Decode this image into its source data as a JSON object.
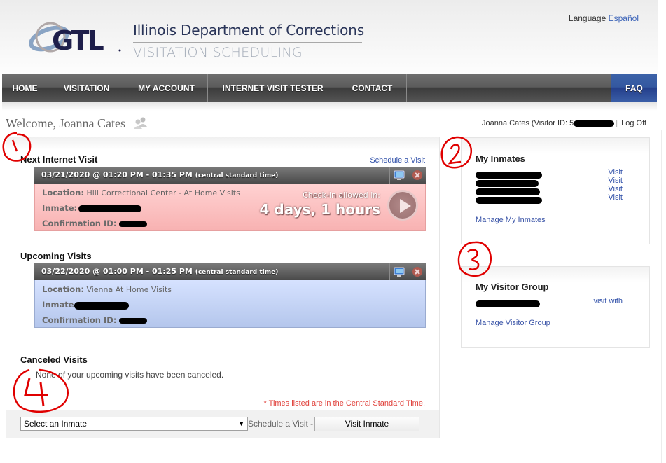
{
  "header": {
    "logo_text": "GTL",
    "title": "Illinois Department of Corrections",
    "subtitle": "VISITATION SCHEDULING",
    "language_label": "Language",
    "language_link": "Español"
  },
  "nav": {
    "items": [
      {
        "label": "HOME"
      },
      {
        "label": "VISITATION"
      },
      {
        "label": "MY ACCOUNT"
      },
      {
        "label": "INTERNET VISIT TESTER"
      },
      {
        "label": "CONTACT"
      }
    ],
    "faq": "FAQ"
  },
  "welcome": {
    "text": "Welcome, Joanna Cates",
    "user_label": "Joanna Cates (Visitor ID: 5",
    "logoff": "Log Off"
  },
  "next_visit": {
    "section_title": "Next Internet Visit",
    "schedule_link": "Schedule a Visit",
    "datetime": "03/21/2020 @ 01:20 PM - 01:35 PM",
    "timezone": "(central standard time)",
    "location_label": "Location:",
    "location": "Hill Correctional Center - At Home Visits",
    "inmate_label": "Inmate:",
    "confirmation_label": "Confirmation ID:",
    "checkin_label": "Check-in allowed in:",
    "checkin_time": "4 days, 1 hours"
  },
  "upcoming": {
    "section_title": "Upcoming Visits",
    "datetime": "03/22/2020 @ 01:00 PM - 01:25 PM",
    "timezone": "(central standard time)",
    "location_label": "Location:",
    "location": "Vienna At Home Visits",
    "inmate_label": "Inmate",
    "confirmation_label": "Confirmation ID:"
  },
  "canceled": {
    "section_title": "Canceled Visits",
    "text": "None of your upcoming visits have been canceled."
  },
  "tz_note": "* Times listed are in the Central Standard Time.",
  "footer": {
    "select_value": "Select an Inmate",
    "schedule_label": "Schedule a Visit -",
    "visit_button": "Visit Inmate"
  },
  "my_inmates": {
    "title": "My Inmates",
    "rows": [
      {
        "action": "Visit"
      },
      {
        "action": "Visit"
      },
      {
        "action": "Visit"
      },
      {
        "action": "Visit"
      }
    ],
    "manage_link": "Manage My Inmates"
  },
  "visitor_group": {
    "title": "My Visitor Group",
    "rows": [
      {
        "action": "visit with"
      }
    ],
    "manage_link": "Manage Visitor Group"
  },
  "annotations": [
    "1",
    "2",
    "3",
    "4"
  ],
  "colors": {
    "nav_bg": "#555555",
    "faq_bg": "#3458a0",
    "link": "#2f4fa8",
    "next_visit_bg": "#f8b2b2",
    "upcoming_bg": "#b4c6ec",
    "tz_note": "#e0403a",
    "annotation": "#e00000"
  }
}
